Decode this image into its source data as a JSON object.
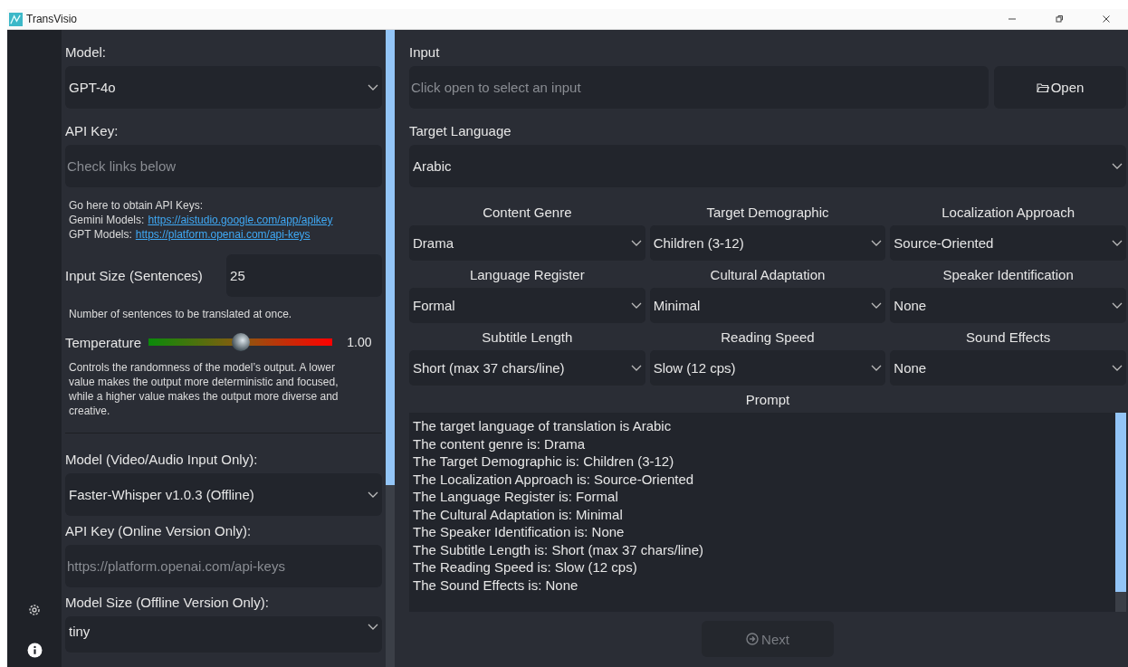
{
  "window": {
    "title": "TransVisio"
  },
  "settings": {
    "model": {
      "label": "Model:",
      "value": "GPT-4o"
    },
    "api_key": {
      "label": "API Key:",
      "placeholder": "Check links below"
    },
    "api_help": {
      "heading": "Go here to obtain API Keys:",
      "links": [
        {
          "label": "Gemini Models:",
          "url": "https://aistudio.google.com/app/apikey"
        },
        {
          "label": "GPT Models:",
          "url": "https://platform.openai.com/api-keys"
        }
      ]
    },
    "input_size": {
      "label": "Input Size (Sentences)",
      "value": "25",
      "note": "Number of sentences to be translated at once."
    },
    "temperature": {
      "label": "Temperature",
      "level": 0.5,
      "reading": "1.00",
      "note": "Controls the randomness of the model’s output. A lower value makes the output more deterministic and focused, while a higher value makes the output more diverse and creative."
    },
    "speech_model": {
      "label": "Model (Video/Audio Input Only):",
      "value": "Faster-Whisper v1.0.3 (Offline)"
    },
    "online_key": {
      "label": "API Key (Online Version Only):",
      "placeholder": "https://platform.openai.com/api-keys"
    },
    "model_size": {
      "label": "Model Size (Offline Version Only):",
      "value": "tiny"
    }
  },
  "main": {
    "input": {
      "label": "Input",
      "placeholder": "Click open to select an input",
      "button": "Open"
    },
    "target_language": {
      "label": "Target Language",
      "value": "Arabic"
    },
    "options": [
      {
        "label": "Content Genre",
        "value": "Drama"
      },
      {
        "label": "Target Demographic",
        "value": "Children (3-12)"
      },
      {
        "label": "Localization Approach",
        "value": "Source-Oriented"
      },
      {
        "label": "Language Register",
        "value": "Formal"
      },
      {
        "label": "Cultural Adaptation",
        "value": "Minimal"
      },
      {
        "label": "Speaker Identification",
        "value": "None"
      },
      {
        "label": "Subtitle Length",
        "value": "Short (max 37 chars/line)"
      },
      {
        "label": "Reading Speed",
        "value": "Slow (12 cps)"
      },
      {
        "label": "Sound Effects",
        "value": "None"
      }
    ],
    "prompt": {
      "label": "Prompt",
      "lines": [
        "The target language of translation is Arabic",
        "The content genre is: Drama",
        "The Target Demographic is: Children (3-12)",
        "The Localization Approach is: Source-Oriented",
        "The Language Register is: Formal",
        "The Cultural Adaptation is: Minimal",
        "The Speaker Identification is: None",
        "The Subtitle Length is: Short (max 37 chars/line)",
        "The Reading Speed is: Slow (12 cps)",
        "The Sound Effects is: None"
      ]
    },
    "next_button": {
      "label": "Next",
      "disabled": true
    }
  }
}
